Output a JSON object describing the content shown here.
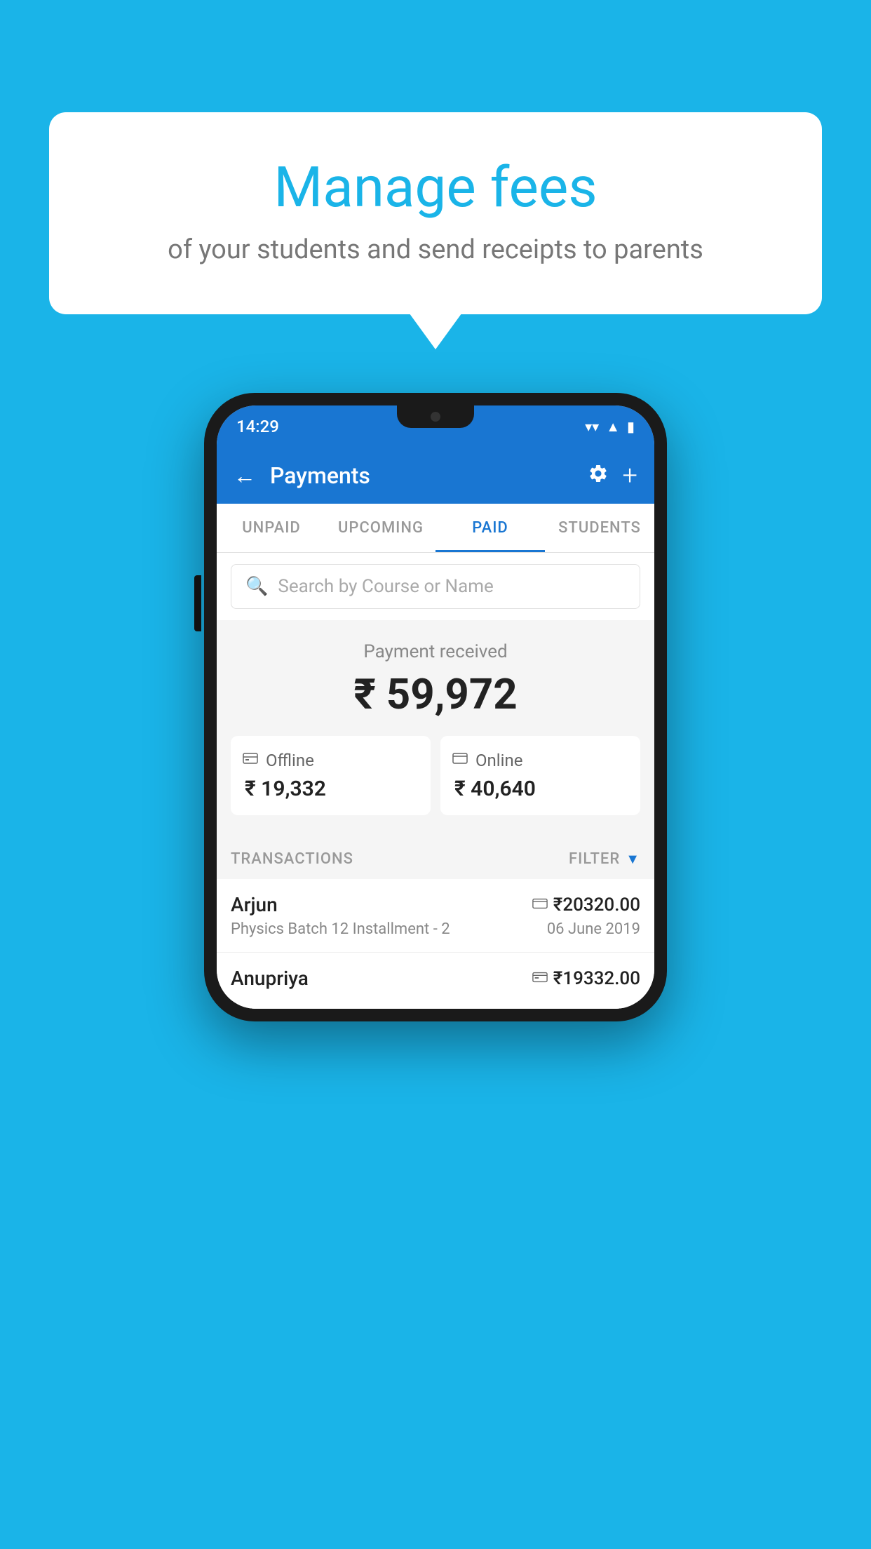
{
  "background_color": "#1ab4e8",
  "speech_bubble": {
    "title": "Manage fees",
    "subtitle": "of your students and send receipts to parents"
  },
  "phone": {
    "status_bar": {
      "time": "14:29",
      "signal": "▲",
      "battery": "▮"
    },
    "app_bar": {
      "back_icon": "←",
      "title": "Payments",
      "settings_label": "settings",
      "add_label": "add"
    },
    "tabs": [
      {
        "label": "UNPAID",
        "active": false
      },
      {
        "label": "UPCOMING",
        "active": false
      },
      {
        "label": "PAID",
        "active": true
      },
      {
        "label": "STUDENTS",
        "active": false
      }
    ],
    "search": {
      "placeholder": "Search by Course or Name"
    },
    "payment_summary": {
      "label": "Payment received",
      "amount": "₹ 59,972",
      "offline": {
        "label": "Offline",
        "amount": "₹ 19,332",
        "icon": "💳"
      },
      "online": {
        "label": "Online",
        "amount": "₹ 40,640",
        "icon": "🏧"
      }
    },
    "transactions": {
      "header_label": "TRANSACTIONS",
      "filter_label": "FILTER",
      "rows": [
        {
          "name": "Arjun",
          "amount": "₹20320.00",
          "course": "Physics Batch 12 Installment - 2",
          "date": "06 June 2019",
          "type": "online"
        },
        {
          "name": "Anupriya",
          "amount": "₹19332.00",
          "course": "",
          "date": "",
          "type": "offline"
        }
      ]
    }
  }
}
